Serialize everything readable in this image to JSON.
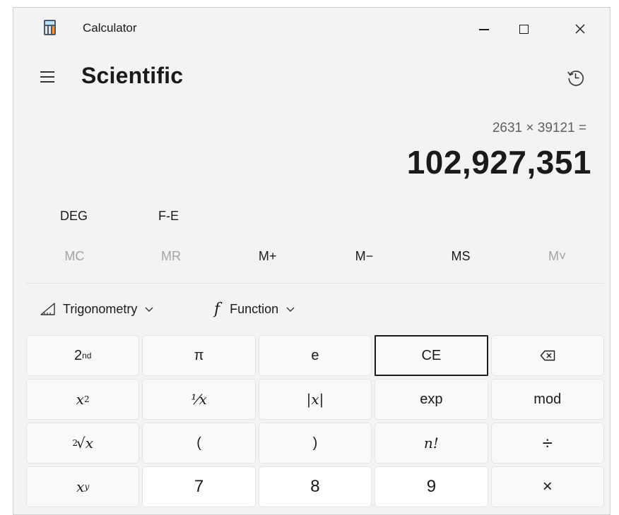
{
  "window": {
    "app_title": "Calculator"
  },
  "header": {
    "mode_title": "Scientific"
  },
  "display": {
    "expression": "2631 × 39121 =",
    "result": "102,927,351"
  },
  "modes": {
    "angle": "DEG",
    "fe": "F-E"
  },
  "memory": [
    {
      "label": "MC",
      "enabled": false
    },
    {
      "label": "MR",
      "enabled": false
    },
    {
      "label": "M+",
      "enabled": true
    },
    {
      "label": "M−",
      "enabled": true
    },
    {
      "label": "MS",
      "enabled": true
    },
    {
      "label": "M˅",
      "enabled": false
    }
  ],
  "functions": {
    "trigonometry_label": "Trigonometry",
    "function_label": "Function"
  },
  "keys": {
    "second": "2",
    "second_sup": "nd",
    "pi": "π",
    "e": "e",
    "ce": "CE",
    "x_sq_base": "x",
    "x_sq_sup": "2",
    "reciprocal": "⅟x",
    "abs": "|x|",
    "exp": "exp",
    "mod": "mod",
    "root_index": "2",
    "root_body": "√x",
    "open_paren": "(",
    "close_paren": ")",
    "factorial": "n!",
    "divide": "÷",
    "x_pow_base": "x",
    "x_pow_sup": "y",
    "seven": "7",
    "eight": "8",
    "nine": "9",
    "multiply": "×"
  }
}
